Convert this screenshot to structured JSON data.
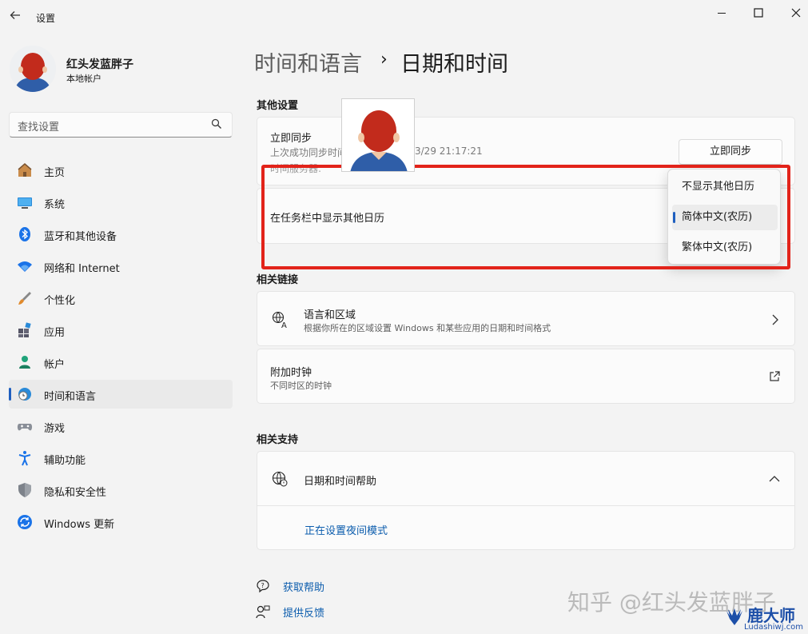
{
  "window": {
    "title": "设置",
    "back_icon": "back-arrow-icon",
    "controls": [
      "minimize-icon",
      "maximize-icon",
      "close-icon"
    ]
  },
  "profile": {
    "name": "红头发蓝胖子",
    "account_type": "本地帐户"
  },
  "search": {
    "placeholder": "查找设置"
  },
  "nav": {
    "items": [
      {
        "label": "主页",
        "icon": "home-icon"
      },
      {
        "label": "系统",
        "icon": "system-icon"
      },
      {
        "label": "蓝牙和其他设备",
        "icon": "bluetooth-icon"
      },
      {
        "label": "网络和 Internet",
        "icon": "wifi-icon"
      },
      {
        "label": "个性化",
        "icon": "brush-icon"
      },
      {
        "label": "应用",
        "icon": "apps-icon"
      },
      {
        "label": "帐户",
        "icon": "account-icon"
      },
      {
        "label": "时间和语言",
        "icon": "time-language-icon",
        "active": true
      },
      {
        "label": "游戏",
        "icon": "gamepad-icon"
      },
      {
        "label": "辅助功能",
        "icon": "accessibility-icon"
      },
      {
        "label": "隐私和安全性",
        "icon": "shield-icon"
      },
      {
        "label": "Windows 更新",
        "icon": "update-icon"
      }
    ]
  },
  "header": {
    "parent": "时间和语言",
    "separator": "›",
    "current": "日期和时间"
  },
  "other_settings": {
    "section_title": "其他设置",
    "sync": {
      "title": "立即同步",
      "last_sync": "上次成功同步时间",
      "last_sync_time": "3/29 21:17:21",
      "server_label": "时间服务器:",
      "button_label": "立即同步"
    },
    "calendar": {
      "title": "在任务栏中显示其他日历",
      "options": [
        "不显示其他日历",
        "简体中文(农历)",
        "繁体中文(农历)"
      ],
      "selected": "简体中文(农历)"
    }
  },
  "related_links": {
    "section_title": "相关链接",
    "language_region": {
      "title": "语言和区域",
      "subtitle": "根据你所在的区域设置 Windows 和某些应用的日期和时间格式"
    },
    "additional_clocks": {
      "title": "附加时钟",
      "subtitle": "不同时区的时钟"
    }
  },
  "related_support": {
    "section_title": "相关支持",
    "help": {
      "title": "日期和时间帮助",
      "link": "正在设置夜间模式"
    }
  },
  "footer": {
    "get_help": "获取帮助",
    "feedback": "提供反馈"
  },
  "watermark": {
    "text": "知乎 @红头发蓝胖子",
    "logo_text": "鹿大师",
    "logo_url_text": "Ludashiwj.com"
  },
  "colors": {
    "accent": "#1f5fbf",
    "highlight": "#e2231a",
    "link": "#0b5cad"
  }
}
